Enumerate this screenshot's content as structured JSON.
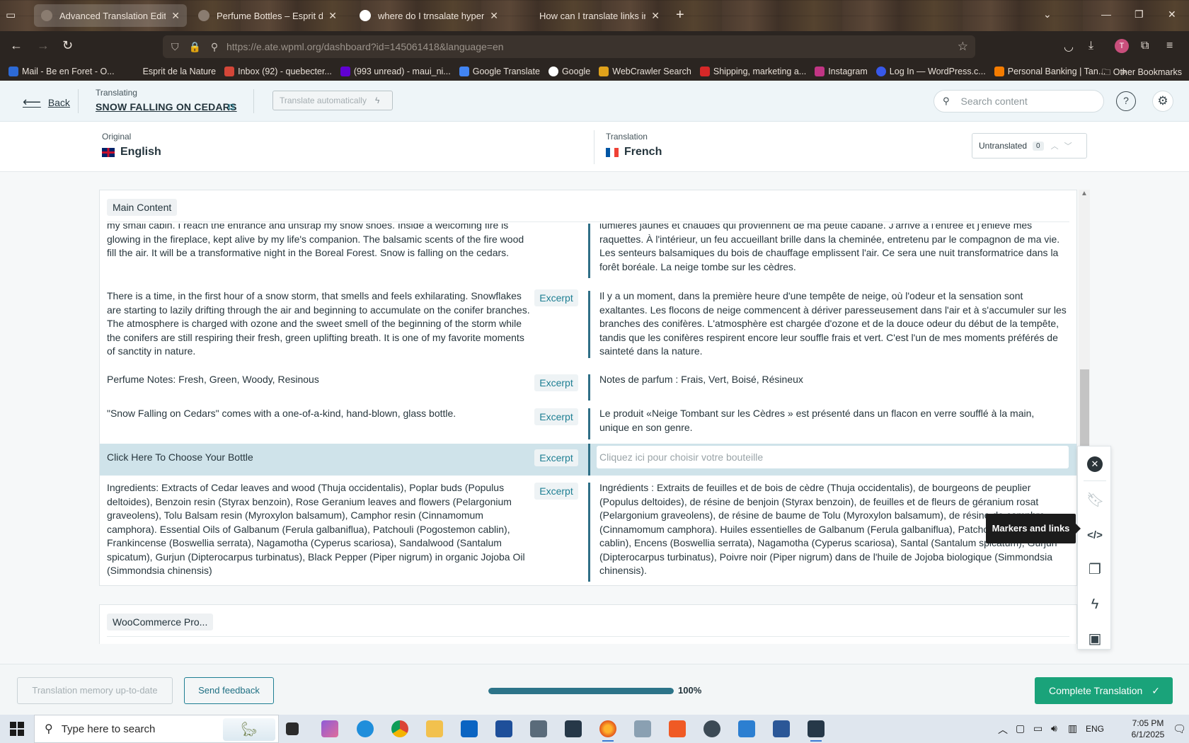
{
  "browser": {
    "tabs": [
      {
        "title": "Advanced Translation Editor - WPML"
      },
      {
        "title": "Perfume Bottles – Esprit de la Nature"
      },
      {
        "title": "where do I trnsalate hyperlinks"
      },
      {
        "title": "How can I translate links in WPML"
      }
    ],
    "url": "https://e.ate.wpml.org/dashboard?id=145061418&language=en",
    "avatar_letter": "T",
    "bookmarks": [
      "Mail - Be en Foret - O...",
      "Esprit de la Nature",
      "Inbox (92) - quebecter...",
      "(993 unread) - maui_ni...",
      "Google Translate",
      "Google",
      "WebCrawler Search",
      "Shipping, marketing a...",
      "Instagram",
      "Log In — WordPress.c...",
      "Personal Banking | Tan..."
    ],
    "other_bookmarks": "Other Bookmarks"
  },
  "header": {
    "back_label": "Back",
    "translating_label": "Translating",
    "doc_title": "SNOW FALLING ON CEDARS",
    "auto_translate_label": "Translate automatically",
    "search_placeholder": "Search content"
  },
  "languages": {
    "original_label": "Original",
    "original_name": "English",
    "translation_label": "Translation",
    "translation_name": "French",
    "untranslated_label": "Untranslated",
    "untranslated_count": "0"
  },
  "sections": {
    "main": "Main Content",
    "woo": "WooCommerce Pro..."
  },
  "excerpt_label": "Excerpt",
  "rows": [
    {
      "source": "my small cabin. I reach the entrance and unstrap my snow shoes. Inside a welcoming fire is glowing in the fireplace, kept alive by my life's companion. The balsamic scents of the fire wood fill the air. It will be a transformative night in the Boreal Forest. Snow is falling on the cedars.",
      "target": "lumières jaunes et chaudes qui proviennent de ma petite cabane. J'arrive à l'entrée et j'enlève mes raquettes. À l'intérieur, un feu accueillant brille dans la cheminée, entretenu par le compagnon de ma vie. Les senteurs balsamiques du bois de chauffage emplissent l'air. Ce sera une nuit transformatrice dans la forêt boréale. La neige tombe sur les cèdres."
    },
    {
      "source": "There is a time, in the first hour of a snow storm, that smells and feels exhilarating. Snowflakes are starting to lazily drifting through the air and beginning to accumulate on the conifer branches. The atmosphere is charged with ozone and the sweet smell of the beginning of the storm while the conifers are still respiring their fresh, green uplifting breath. It is one of my favorite moments of sanctity in nature.",
      "target": "Il y a un moment, dans la première heure d'une tempête de neige, où l'odeur et la sensation sont exaltantes. Les flocons de neige commencent à dériver paresseusement dans l'air et à s'accumuler sur les branches des conifères. L'atmosphère est chargée d'ozone et de la douce odeur du début de la tempête, tandis que les conifères respirent encore leur souffle frais et vert. C'est l'un de mes moments préférés de sainteté dans la nature."
    },
    {
      "source": "Perfume Notes: Fresh, Green, Woody, Resinous",
      "target": "Notes de parfum : Frais, Vert, Boisé, Résineux"
    },
    {
      "source": "\"Snow Falling on Cedars\" comes with a one-of-a-kind, hand-blown, glass bottle.",
      "target": "Le produit «Neige Tombant sur les Cèdres » est présenté dans un flacon en verre soufflé à la main, unique en son genre."
    },
    {
      "source": "Click Here To Choose Your Bottle",
      "target_placeholder": "Cliquez ici pour choisir votre bouteille"
    },
    {
      "source": "Ingredients: Extracts of Cedar leaves and wood (Thuja occidentalis), Poplar buds (Populus deltoides), Benzoin resin (Styrax benzoin), Rose Geranium leaves and flowers (Pelargonium graveolens), Tolu Balsam resin (Myroxylon balsamum), Camphor resin (Cinnamomum camphora). Essential Oils of Galbanum (Ferula galbaniflua), Patchouli (Pogostemon cablin), Frankincense (Boswellia serrata), Nagamotha (Cyperus scariosa), Sandalwood (Santalum spicatum), Gurjun (Dipterocarpus turbinatus), Black Pepper (Piper nigrum) in organic Jojoba Oil (Simmondsia chinensis)",
      "target": "Ingrédients : Extraits de feuilles et de bois de cèdre (Thuja occidentalis), de bourgeons de peuplier (Populus deltoides), de résine de benjoin (Styrax benzoin), de feuilles et de fleurs de géranium rosat (Pelargonium graveolens), de résine de baume de Tolu (Myroxylon balsamum), de résine de camphre (Cinnamomum camphora). Huiles essentielles de Galbanum (Ferula galbaniflua), Patchouli (Pogostemon cablin), Encens (Boswellia serrata), Nagamotha (Cyperus scariosa), Santal (Santalum spicatum), Gurjun (Dipterocarpus turbinatus), Poivre noir (Piper nigrum) dans de l'huile de Jojoba biologique (Simmondsia chinensis)."
    }
  ],
  "tooltip": "Markers and links",
  "footer": {
    "tm_label": "Translation memory up-to-date",
    "feedback_label": "Send feedback",
    "progress": 100,
    "progress_label": "100%",
    "complete_label": "Complete Translation"
  },
  "taskbar": {
    "search_placeholder": "Type here to search",
    "lang": "ENG",
    "time": "7:05 PM",
    "date": "6/1/2025"
  },
  "colors": {
    "accent": "#1e7f93",
    "complete": "#1aa37a",
    "selected_row": "#cfe3ea"
  }
}
